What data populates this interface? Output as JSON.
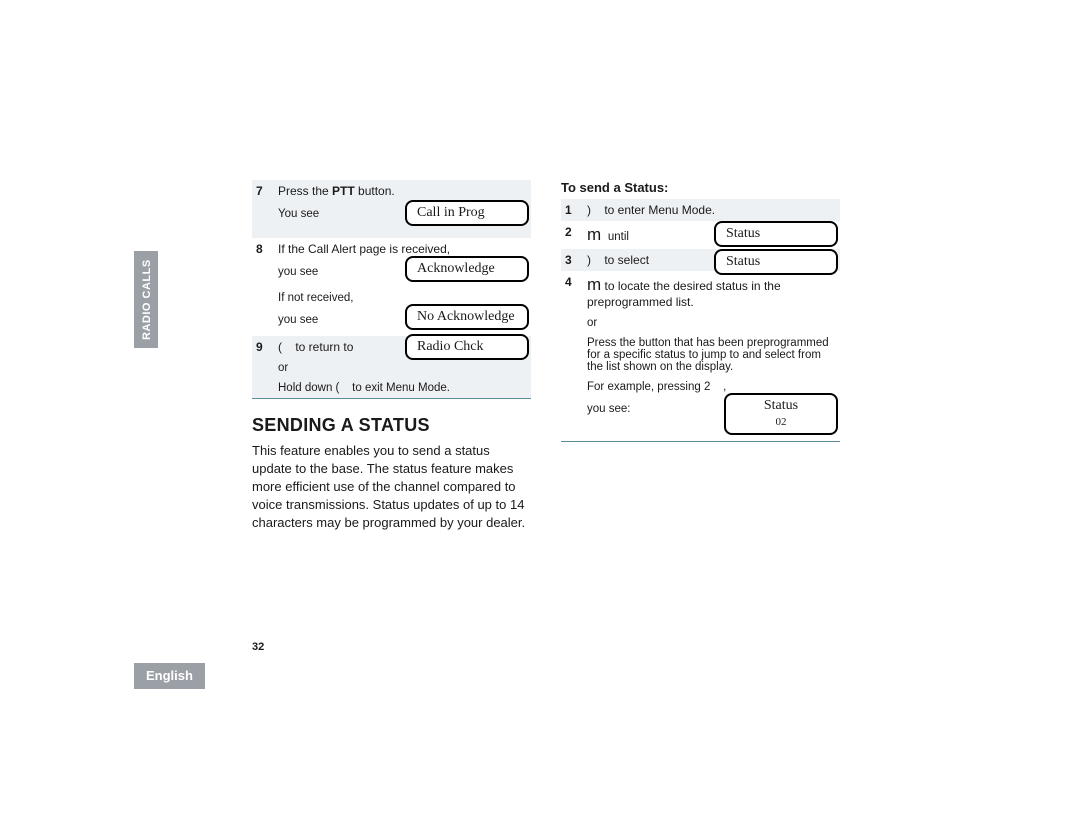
{
  "sidebar": {
    "section": "RADIO CALLS",
    "language": "English",
    "pagenum": "32"
  },
  "left": {
    "step7": {
      "num": "7",
      "line1_a": "Press the ",
      "ptt": "PTT",
      "line1_b": " button.",
      "line2": "You see"
    },
    "lcd7": {
      "l1": "Call in Prog"
    },
    "step8": {
      "num": "8",
      "line1": "If the Call Alert page is received,",
      "line2": "you see",
      "line3": "If not received,",
      "line4": "you see"
    },
    "lcd8a": {
      "l1": "Acknowledge"
    },
    "lcd8b": {
      "l1": "No Acknowledge"
    },
    "step9": {
      "num": "9",
      "icon": "(",
      "line1": "to return to",
      "line2": "or",
      "line3a": "Hold down ",
      "line3icon": "(",
      "line3b": " to exit Menu Mode."
    },
    "lcd9": {
      "l1": "Radio Chck"
    },
    "heading": "SENDING A STATUS",
    "body": "This feature enables you to send a status update to the base. The status feature makes more efficient use of the channel compared to voice transmissions. Status updates of up to 14 characters may be programmed by your dealer."
  },
  "right": {
    "lead": "To send a Status:",
    "s1": {
      "num": "1",
      "icon": ")",
      "text": "to enter Menu Mode."
    },
    "s2": {
      "num": "2",
      "icon": "m",
      "text": "until"
    },
    "lcd2": {
      "l1": "Status"
    },
    "s3": {
      "num": "3",
      "icon": ")",
      "text": "to select"
    },
    "lcd3": {
      "l1": "Status"
    },
    "s4": {
      "num": "4",
      "icon": "m",
      "line1": "to locate the desired status in the preprogrammed list.",
      "or": "or",
      "line2": "Press the button that has been preprogrammed for a specific status to jump to and select from the list shown on the display.",
      "line3a": "For example, pressing ",
      "line3b": "2",
      "line3c": " ,",
      "line4": "you see:"
    },
    "lcd4": {
      "l1": "Status",
      "l2": "02"
    }
  }
}
